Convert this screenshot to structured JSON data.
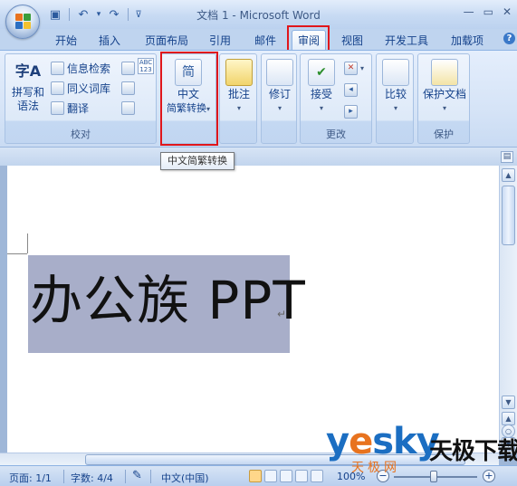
{
  "window": {
    "title": "文档 1 - Microsoft Word",
    "controls": [
      "—",
      "▭",
      "✕"
    ]
  },
  "quick_access": {
    "icons": [
      "save-icon",
      "undo-icon",
      "redo-icon",
      "customize-icon"
    ],
    "glyphs": {
      "save": "▣",
      "undo": "↶",
      "dropdown": "▾",
      "redo": "↷",
      "customize": "⊽"
    }
  },
  "tabs": [
    {
      "label": "开始"
    },
    {
      "label": "插入"
    },
    {
      "label": "页面布局"
    },
    {
      "label": "引用"
    },
    {
      "label": "邮件"
    },
    {
      "label": "审阅",
      "active": true
    },
    {
      "label": "视图"
    },
    {
      "label": "开发工具"
    },
    {
      "label": "加载项"
    }
  ],
  "ribbon": {
    "proofing": {
      "label": "校对",
      "spelling": {
        "line1": "拼写和",
        "line2": "语法",
        "icon_text": "字A"
      },
      "research": "信息检索",
      "thesaurus": "同义词库",
      "translate": "翻译",
      "word_count_icon": "ABC 123"
    },
    "chinese": {
      "icon_text": "简",
      "line1": "中文",
      "line2": "简繁转换"
    },
    "comments": {
      "label": "批注"
    },
    "tracking": {
      "label": "修订"
    },
    "changes": {
      "label": "更改",
      "accept": "接受"
    },
    "compare": {
      "label": "比较"
    },
    "protect": {
      "group_label": "保护",
      "label": "保护文档"
    },
    "help": "?"
  },
  "tooltip": "中文简繁转换",
  "document": {
    "text": "办公族 PPT",
    "paragraph_mark": "↵"
  },
  "status": {
    "page": "页面: 1/1",
    "words": "字数: 4/4",
    "language": "中文(中国)",
    "zoom": "100%",
    "zoom_minus": "−",
    "zoom_plus": "+"
  },
  "watermark": {
    "brand_start": "y",
    "brand_e": "e",
    "brand_end": "sky",
    "cn_name": "天极下载",
    "cn_net": "天极网"
  },
  "colors": {
    "ribbon_text": "#15428b",
    "selection": "#a8aec9",
    "highlight_box": "#e0161b",
    "watermark_blue": "#1b6ec2",
    "watermark_orange": "#e8731f"
  }
}
